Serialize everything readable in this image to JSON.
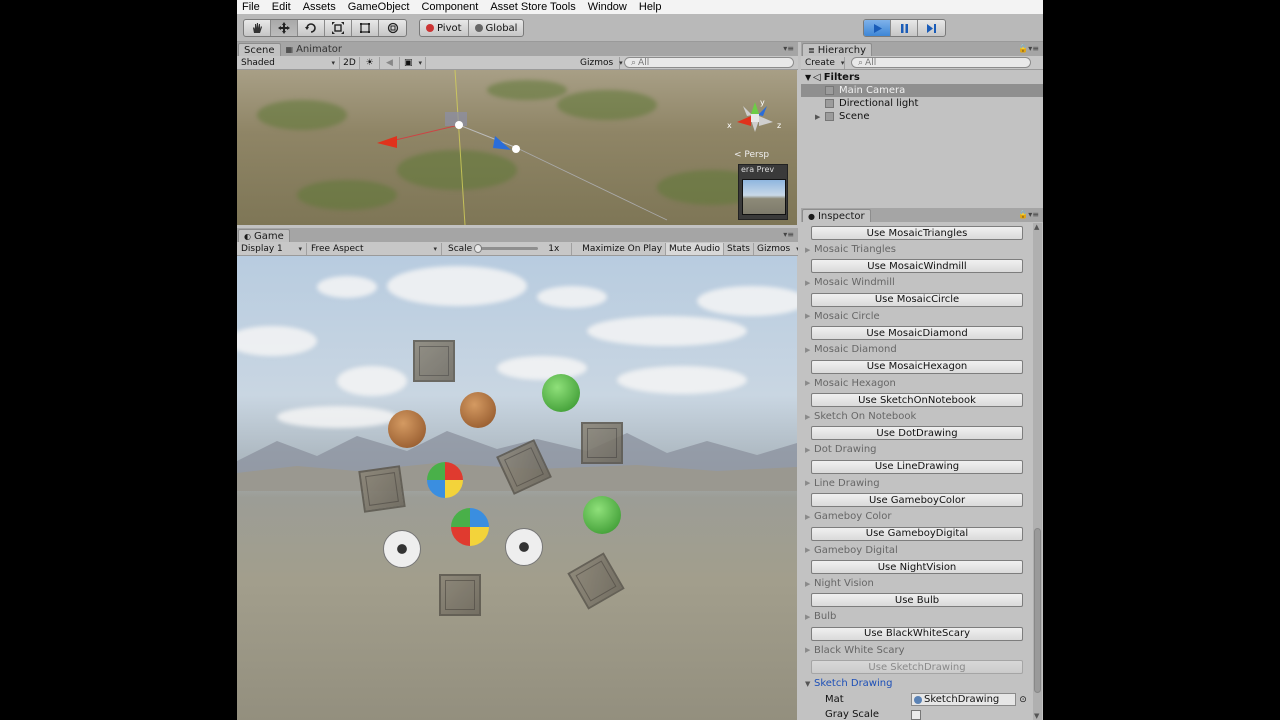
{
  "menu": [
    "File",
    "Edit",
    "Assets",
    "GameObject",
    "Component",
    "Asset Store Tools",
    "Window",
    "Help"
  ],
  "toolbar": {
    "tools": [
      "hand-icon",
      "move-icon",
      "rotate-icon",
      "scale-icon",
      "rect-icon",
      "transform-icon"
    ],
    "pivot_label": "Pivot",
    "global_label": "Global",
    "play_controls": [
      "play-icon",
      "pause-icon",
      "step-icon"
    ]
  },
  "scene": {
    "tabs": [
      "Scene",
      "Animator"
    ],
    "shading": "Shaded",
    "mode_2d": "2D",
    "gizmos": "Gizmos",
    "search_placeholder": "All",
    "persp_label": "< Persp",
    "camera_preview_label": "era Prev",
    "gizmo_axes": [
      "y",
      "x",
      "z"
    ]
  },
  "game": {
    "tab": "Game",
    "display": "Display 1",
    "aspect": "Free Aspect",
    "scale_label": "Scale",
    "scale_value": "1x",
    "maximize_on_play": "Maximize On Play",
    "mute_audio": "Mute Audio",
    "stats": "Stats",
    "gizmos": "Gizmos"
  },
  "hierarchy": {
    "tab": "Hierarchy",
    "create": "Create",
    "search_placeholder": "All",
    "root": "Filters",
    "items": [
      {
        "label": "Main Camera",
        "selected": true
      },
      {
        "label": "Directional light",
        "selected": false
      },
      {
        "label": "Scene",
        "selected": false
      }
    ]
  },
  "inspector": {
    "tab": "Inspector",
    "entries": [
      {
        "button": "Use MosaicTriangles",
        "section": "Mosaic Triangles"
      },
      {
        "button": "Use MosaicWindmill",
        "section": "Mosaic Windmill"
      },
      {
        "button": "Use MosaicCircle",
        "section": "Mosaic Circle"
      },
      {
        "button": "Use MosaicDiamond",
        "section": "Mosaic Diamond"
      },
      {
        "button": "Use MosaicHexagon",
        "section": "Mosaic Hexagon"
      },
      {
        "button": "Use SketchOnNotebook",
        "section": "Sketch On Notebook"
      },
      {
        "button": "Use DotDrawing",
        "section": "Dot Drawing"
      },
      {
        "button": "Use LineDrawing",
        "section": "Line Drawing"
      },
      {
        "button": "Use GameboyColor",
        "section": "Gameboy Color"
      },
      {
        "button": "Use GameboyDigital",
        "section": "Gameboy Digital"
      },
      {
        "button": "Use NightVision",
        "section": "Night Vision"
      },
      {
        "button": "Use Bulb",
        "section": "Bulb"
      },
      {
        "button": "Use BlackWhiteScary",
        "section": "Black White Scary"
      },
      {
        "button": "Use SketchDrawing",
        "section": "Sketch Drawing",
        "disabled": true,
        "open": true
      }
    ],
    "mat_label": "Mat",
    "mat_value": "SketchDrawing",
    "gray_scale_label": "Gray Scale"
  },
  "colors": {
    "accent": "#3e86d6",
    "selected_row": "#8f8f8f",
    "open_section": "#1c4fb7"
  }
}
